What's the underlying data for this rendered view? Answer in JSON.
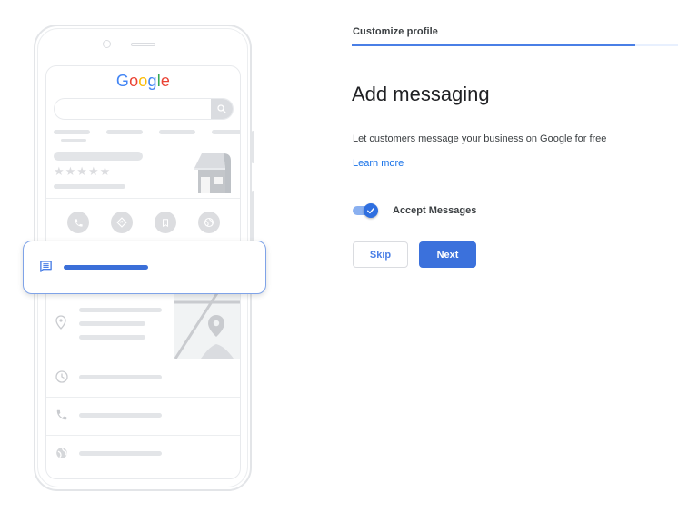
{
  "illustration": {
    "brand_logo": {
      "letters": [
        "G",
        "o",
        "o",
        "g",
        "l",
        "e"
      ],
      "colors": [
        "#4285F4",
        "#EA4335",
        "#FBBC05",
        "#4285F4",
        "#34A853",
        "#EA4335"
      ]
    },
    "action_icons": [
      "phone-icon",
      "directions-icon",
      "bookmark-icon",
      "website-icon"
    ],
    "list_icons": [
      "location-pin-icon",
      "clock-icon",
      "phone-icon",
      "globe-icon"
    ],
    "highlight_icon": "message-icon"
  },
  "header": {
    "step_label": "Customize profile",
    "progress_percent": 87
  },
  "content": {
    "title": "Add messaging",
    "description": "Let customers message your business on Google for free",
    "learn_more": "Learn more",
    "toggle": {
      "label": "Accept Messages",
      "checked": true
    }
  },
  "actions": {
    "skip_label": "Skip",
    "next_label": "Next"
  },
  "colors": {
    "accent": "#3b71dc",
    "link": "#1a73e8",
    "progress_track": "#e8f0fe",
    "placeholder_gray": "#e3e5e8"
  }
}
